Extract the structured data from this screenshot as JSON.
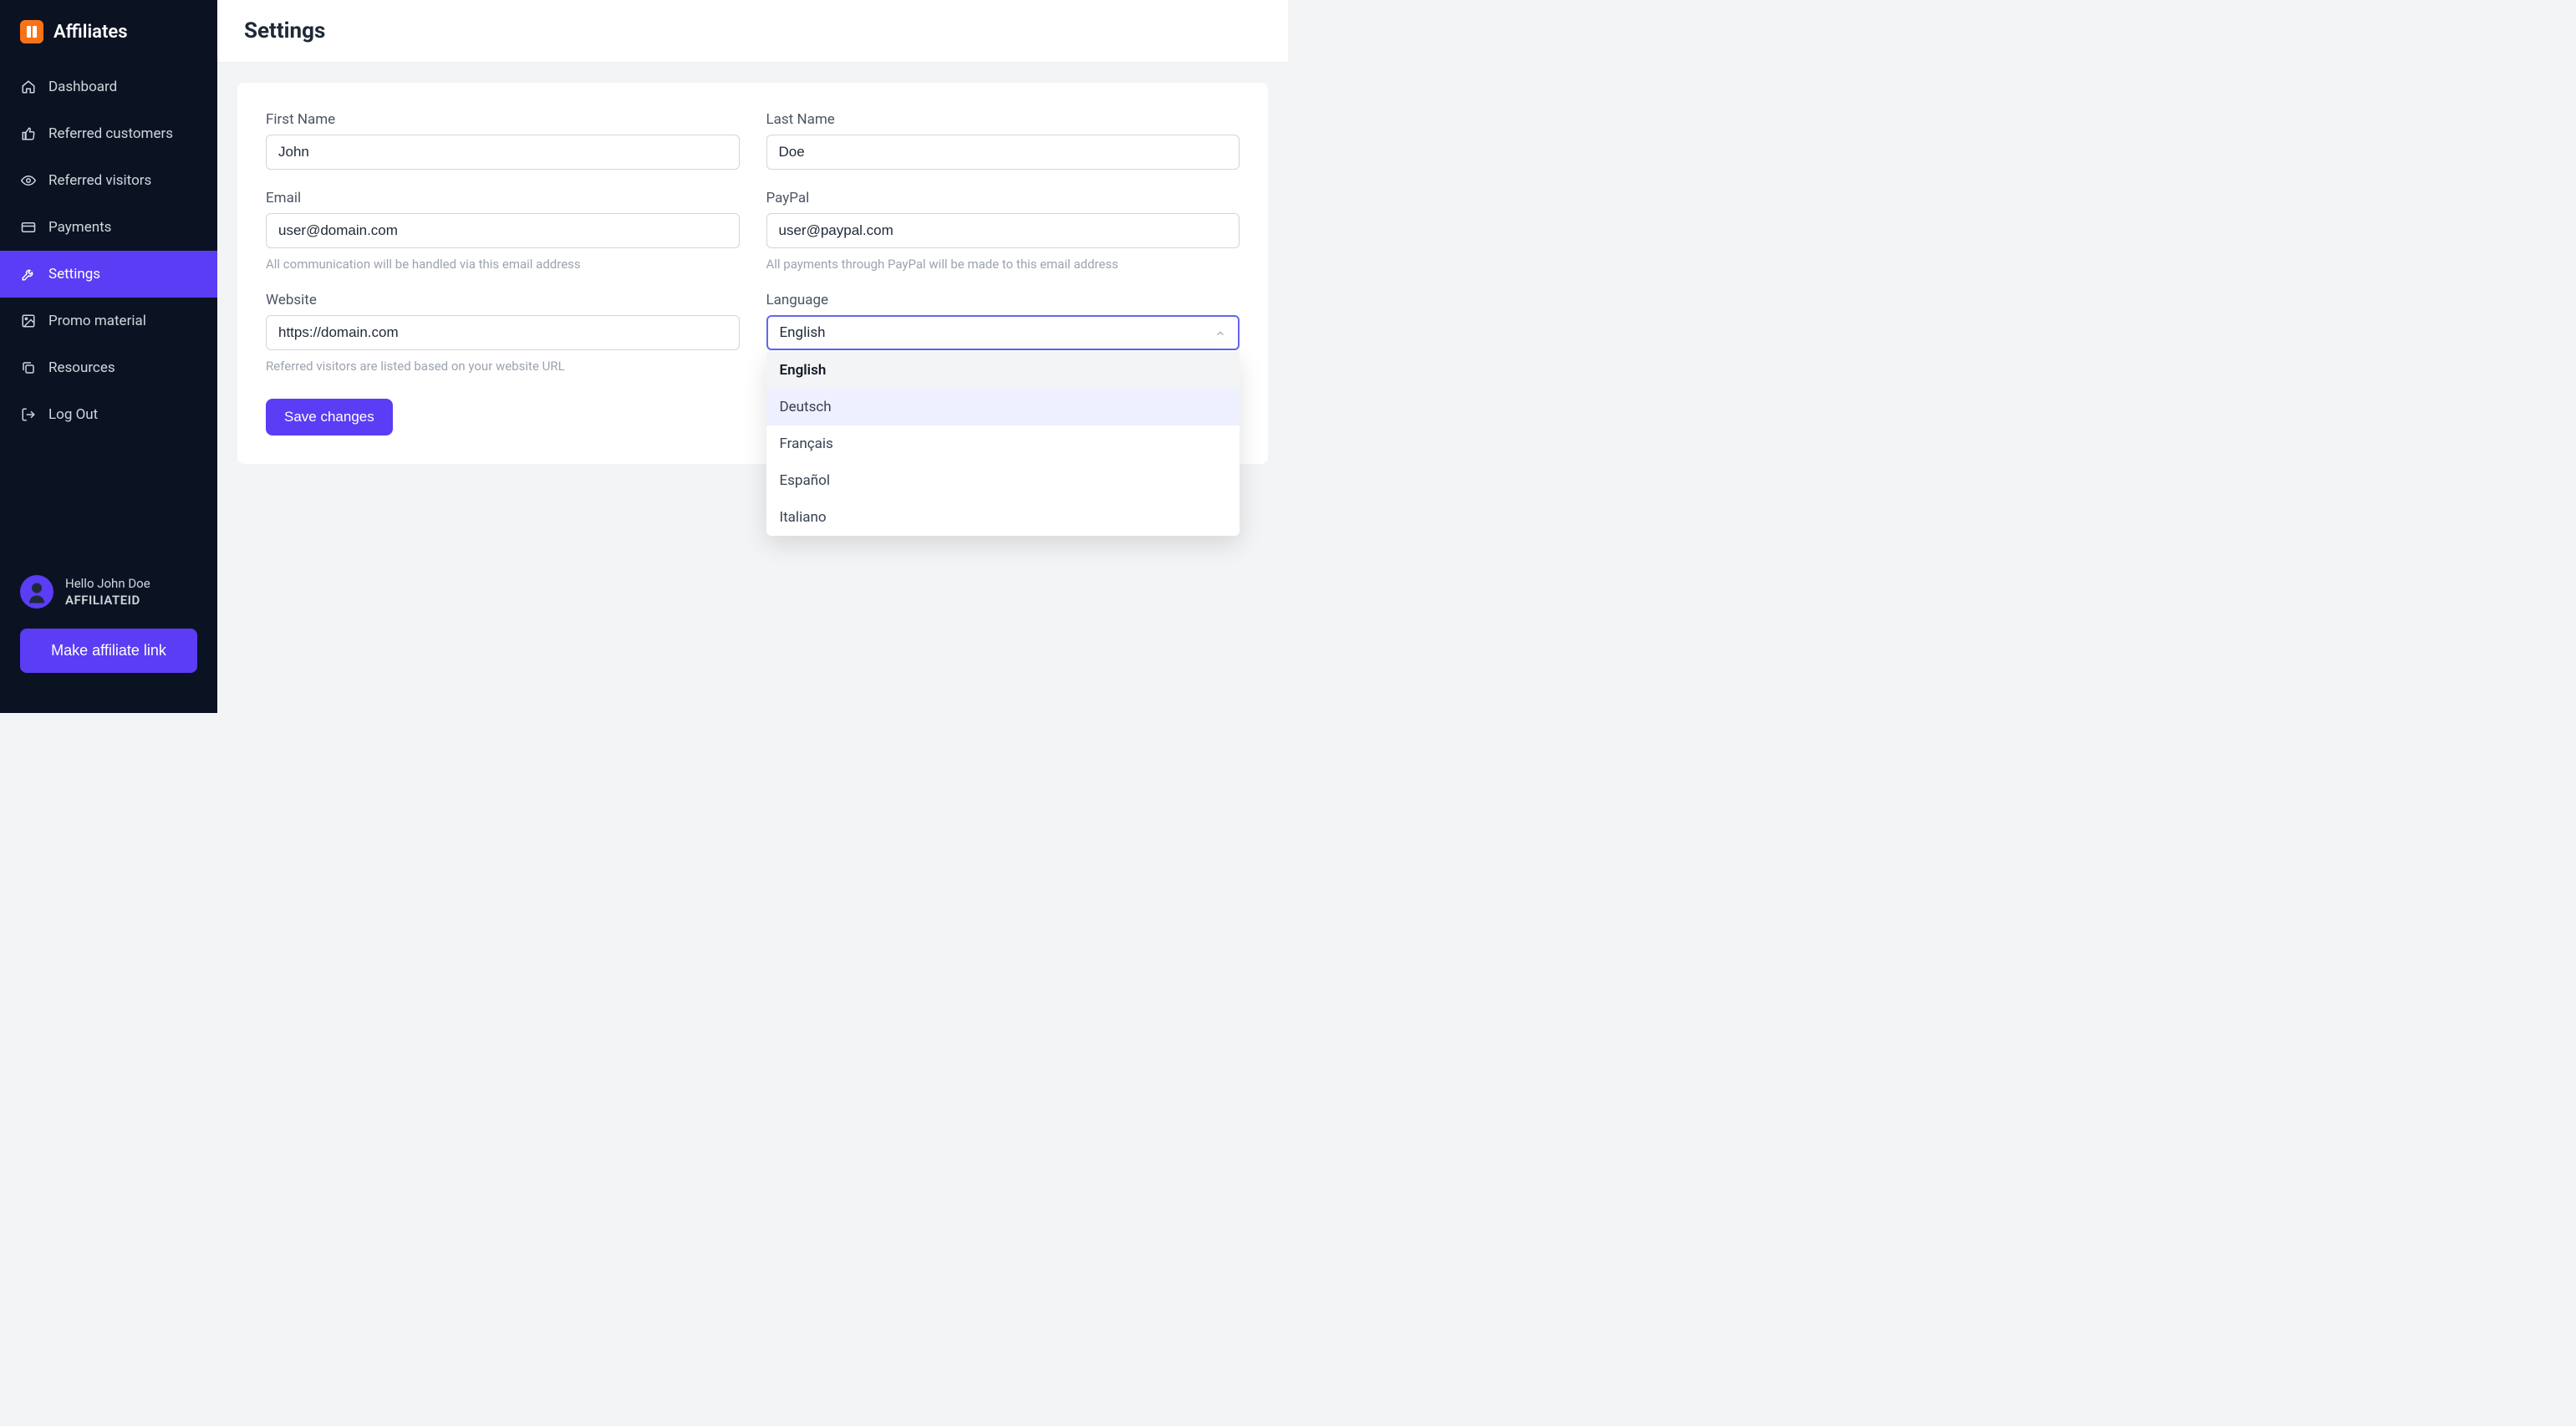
{
  "brand": {
    "title": "Affiliates"
  },
  "nav": {
    "items": [
      {
        "key": "dashboard",
        "label": "Dashboard"
      },
      {
        "key": "referred-customers",
        "label": "Referred customers"
      },
      {
        "key": "referred-visitors",
        "label": "Referred visitors"
      },
      {
        "key": "payments",
        "label": "Payments"
      },
      {
        "key": "settings",
        "label": "Settings"
      },
      {
        "key": "promo-material",
        "label": "Promo material"
      },
      {
        "key": "resources",
        "label": "Resources"
      },
      {
        "key": "logout",
        "label": "Log Out"
      }
    ],
    "active_key": "settings"
  },
  "user": {
    "greeting": "Hello John Doe",
    "affiliate_id": "AFFILIATEID"
  },
  "sidebar_button": {
    "label": "Make affiliate link"
  },
  "page": {
    "title": "Settings"
  },
  "form": {
    "first_name": {
      "label": "First Name",
      "value": "John"
    },
    "last_name": {
      "label": "Last Name",
      "value": "Doe"
    },
    "email": {
      "label": "Email",
      "value": "user@domain.com",
      "help": "All communication will be handled via this email address"
    },
    "paypal": {
      "label": "PayPal",
      "value": "user@paypal.com",
      "help": "All payments through PayPal will be made to this email address"
    },
    "website": {
      "label": "Website",
      "value": "https://domain.com",
      "help": "Referred visitors are listed based on your website URL"
    },
    "language": {
      "label": "Language",
      "selected": "English",
      "options": [
        "English",
        "Deutsch",
        "Français",
        "Español",
        "Italiano"
      ],
      "hover_index": 1
    },
    "save": {
      "label": "Save changes"
    }
  },
  "colors": {
    "accent": "#5b3df5",
    "sidebar_bg": "#0b1323",
    "logo": "#f97316"
  }
}
